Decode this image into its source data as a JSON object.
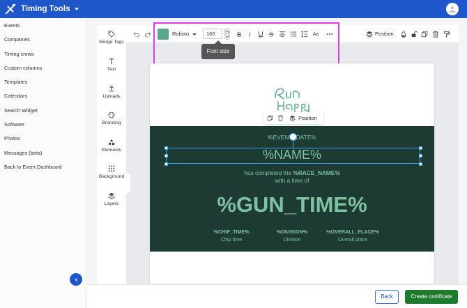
{
  "app": {
    "title": "Timing Tools"
  },
  "sidebar": {
    "items": [
      {
        "label": "Events"
      },
      {
        "label": "Companies"
      },
      {
        "label": "Timing crews"
      },
      {
        "label": "Custom columns"
      },
      {
        "label": "Templates"
      },
      {
        "label": "Calendars"
      },
      {
        "label": "Search Widget"
      },
      {
        "label": "Software"
      },
      {
        "label": "Photos"
      },
      {
        "label": "Messages (beta)"
      },
      {
        "label": "Back to Event Dashboard"
      }
    ]
  },
  "tools": {
    "merge_tags": "Merge Tags",
    "text": "Text",
    "uploads": "Uploads",
    "branding": "Branding",
    "elements": "Elements",
    "background": "Background",
    "layers": "Layers"
  },
  "toolbar": {
    "font": "Roboto",
    "font_size": "160",
    "tooltip": "Font size",
    "position": "Position",
    "text_color": "#5aa88c",
    "case_glyph": "Aa"
  },
  "certificate": {
    "event_date": "%EVENT_DATE%",
    "name": "%NAME%",
    "completed_prefix": "has completed the",
    "race_name": "%RACE_NAME%",
    "time_of": "with a time of",
    "gun_time": "%GUN_TIME%",
    "stats": [
      {
        "value": "%CHIP_TIME%",
        "label": "Chip time"
      },
      {
        "value": "%DIVISION%",
        "label": "Division"
      },
      {
        "value": "%OVERALL_PLACE%",
        "label": "Overall place"
      }
    ],
    "background_color": "#1d3b33",
    "text_color": "#7fc1a3",
    "logo_text": "Run Happy"
  },
  "element_toolbar": {
    "position": "Position"
  },
  "footer": {
    "back": "Back",
    "create": "Create certificate"
  }
}
